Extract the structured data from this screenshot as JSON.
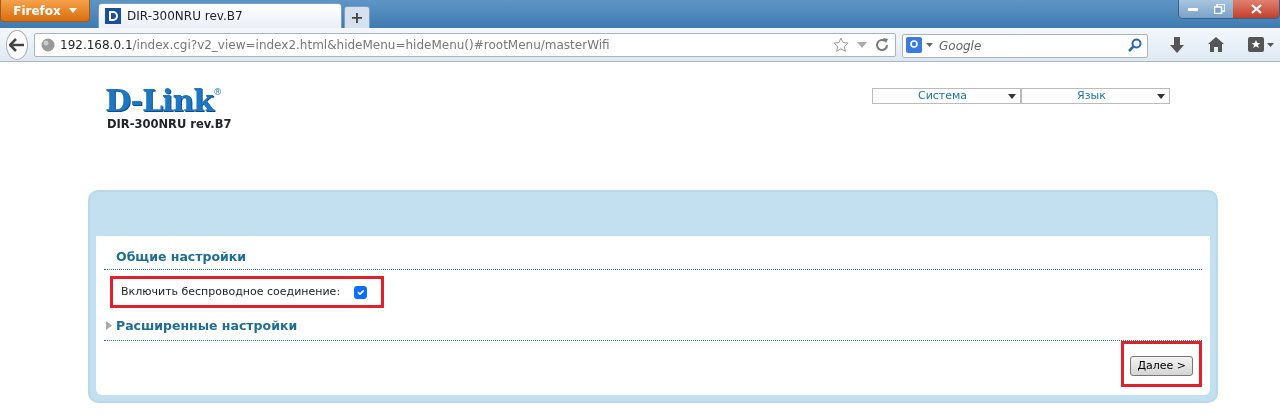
{
  "browser": {
    "app_button": "Firefox",
    "tab": {
      "title": "DIR-300NRU rev.B7",
      "selected": true
    },
    "new_tab": "+",
    "url_host": "192.168.0.1",
    "url_path": "/index.cgi?v2_view=index2.html&hideMenu=hideMenu()#rootMenu/masterWifi",
    "search_placeholder": "Google"
  },
  "header": {
    "logo": "D-Link",
    "logo_mark": "®",
    "model": "DIR-300NRU rev.B7"
  },
  "menus": [
    {
      "label": "Система"
    },
    {
      "label": "Язык"
    }
  ],
  "sections": [
    {
      "title": "Общие настройки",
      "kind": "open",
      "rows": [
        {
          "label": "Включить беспроводное соединение:",
          "checked": true,
          "highlighted": true
        }
      ]
    },
    {
      "title": "Расширенные настройки",
      "kind": "collapsed"
    }
  ],
  "next_button": {
    "label": "Далее >",
    "highlighted": true
  }
}
